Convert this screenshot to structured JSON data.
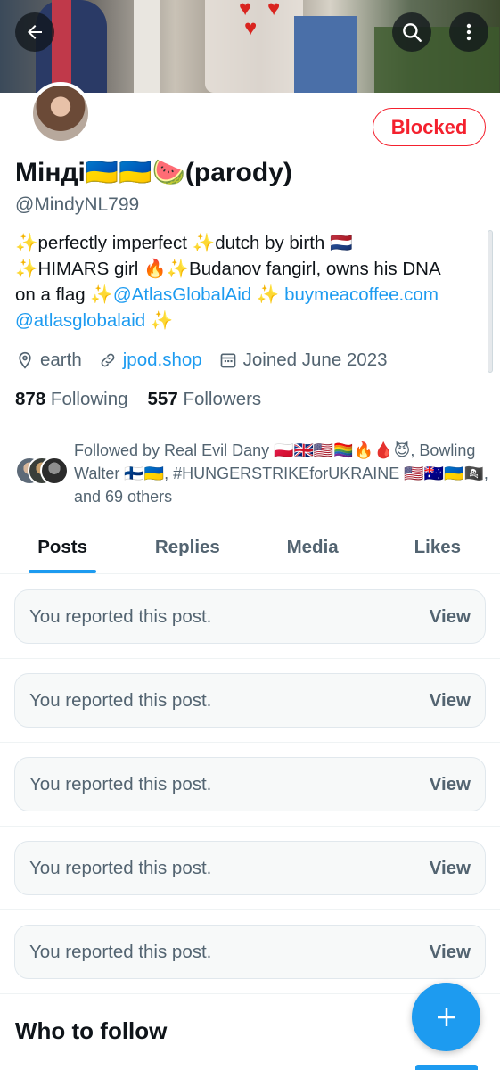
{
  "header": {
    "back_icon": "back-arrow-icon",
    "search_icon": "search-icon",
    "more_icon": "more-vertical-icon"
  },
  "profile": {
    "display_name": "Мінді🇺🇦🇺🇦🍉(parody)",
    "handle": "@MindyNL799",
    "action_button": "Blocked",
    "bio": {
      "line1": "✨perfectly imperfect ✨dutch by birth 🇳🇱",
      "line2": "✨HIMARS girl 🔥✨Budanov fangirl, owns his DNA",
      "line3_prefix": "on a flag ✨",
      "mention1": "@AtlasGlobalAid",
      "line3_mid": " ✨ ",
      "link1": "buymeacoffee.com",
      "mention2": "@atlasglobalaid",
      "line4_suffix": " ✨"
    },
    "location": "earth",
    "website": "jpod.shop",
    "joined": "Joined June 2023",
    "following_count": "878",
    "following_label": "Following",
    "followers_count": "557",
    "followers_label": "Followers",
    "followed_by": "Followed by Real Evil Dany 🇵🇱🇬🇧🇺🇸🏳️‍🌈🔥🩸😈, Bowling Walter 🇫🇮🇺🇦, #HUNGERSTRIKEforUKRAINE 🇺🇸🇦🇺🇺🇦🏴‍☠️, and 69 others"
  },
  "tabs": [
    {
      "label": "Posts",
      "active": true
    },
    {
      "label": "Replies",
      "active": false
    },
    {
      "label": "Media",
      "active": false
    },
    {
      "label": "Likes",
      "active": false
    }
  ],
  "reported_posts": [
    {
      "message": "You reported this post.",
      "action": "View"
    },
    {
      "message": "You reported this post.",
      "action": "View"
    },
    {
      "message": "You reported this post.",
      "action": "View"
    },
    {
      "message": "You reported this post.",
      "action": "View"
    },
    {
      "message": "You reported this post.",
      "action": "View"
    }
  ],
  "who_to_follow": "Who to follow",
  "fab_icon": "plus-icon",
  "colors": {
    "accent": "#1d9bf0",
    "blocked": "#f4212e",
    "secondary_text": "#536471"
  }
}
